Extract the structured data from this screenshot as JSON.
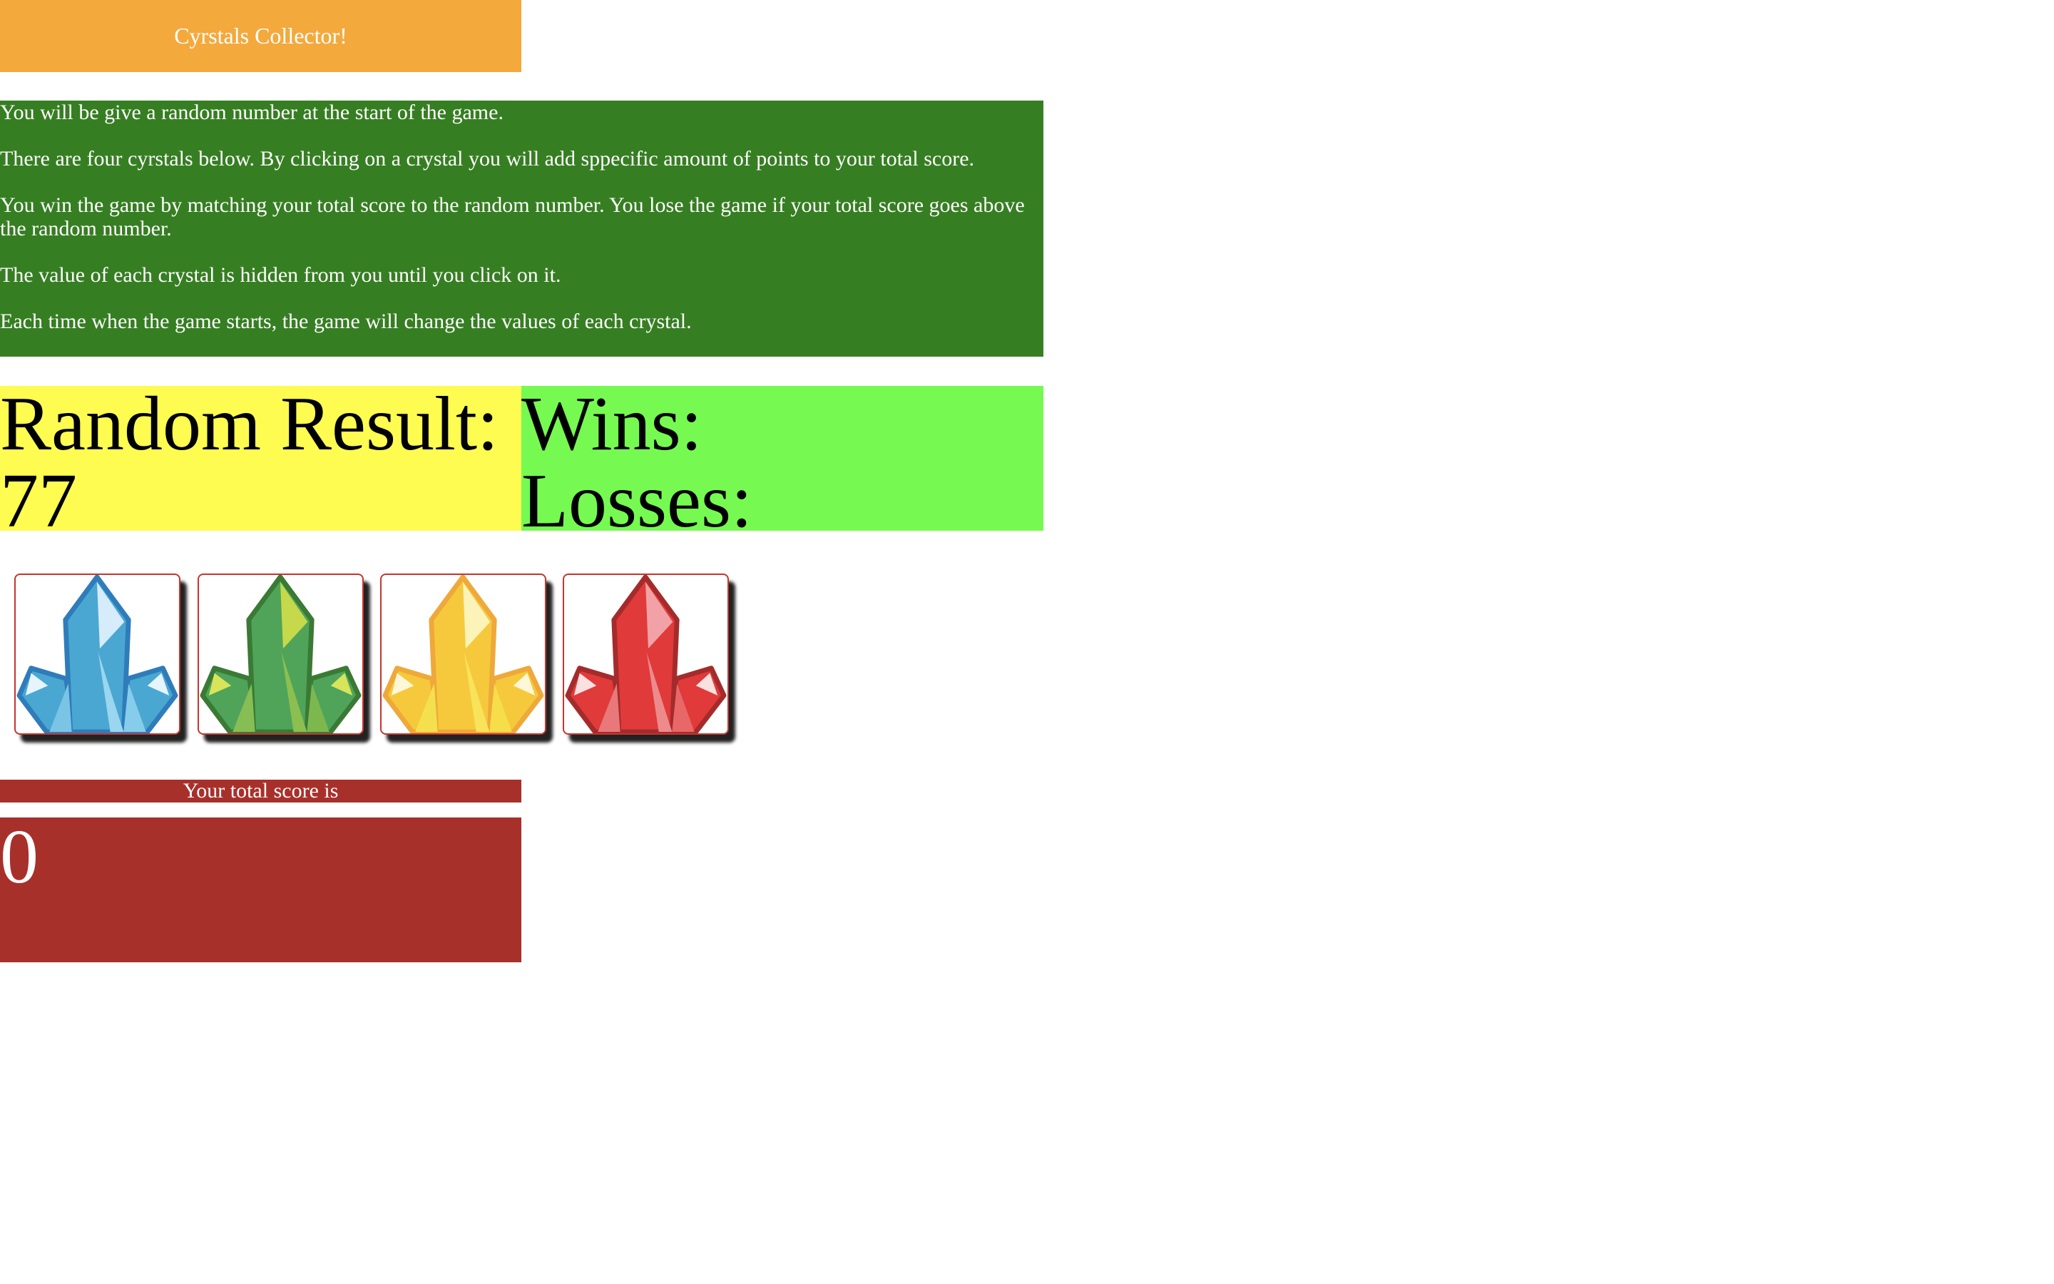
{
  "header": {
    "title": "Cyrstals Collector!"
  },
  "instructions": [
    "You will be give a random number at the start of the game.",
    "There are four cyrstals below. By clicking on a crystal you will add sppecific amount of points to your total score.",
    "You win the game by matching your total score to the random number. You lose the game if your total score goes above the random number.",
    "The value of each crystal is hidden from you until you click on it.",
    "Each time when the game starts, the game will change the values of each crystal."
  ],
  "random": {
    "label": "Random Result:",
    "value": "77"
  },
  "stats": {
    "wins_label": "Wins:",
    "losses_label": "Losses:"
  },
  "crystals": [
    {
      "name": "blue-crystal-icon",
      "color": "#4AA7D2"
    },
    {
      "name": "green-crystal-icon",
      "color": "#4FA45A"
    },
    {
      "name": "yellow-crystal-icon",
      "color": "#F6C93C"
    },
    {
      "name": "red-crystal-icon",
      "color": "#E03A3A"
    }
  ],
  "score": {
    "label": "Your total score is",
    "value": "0"
  },
  "colors": {
    "title_bg": "#F4A93D",
    "instructions_bg": "#367E22",
    "random_bg": "#FEFC51",
    "stats_bg": "#76FA51",
    "score_bg": "#A8302B"
  }
}
